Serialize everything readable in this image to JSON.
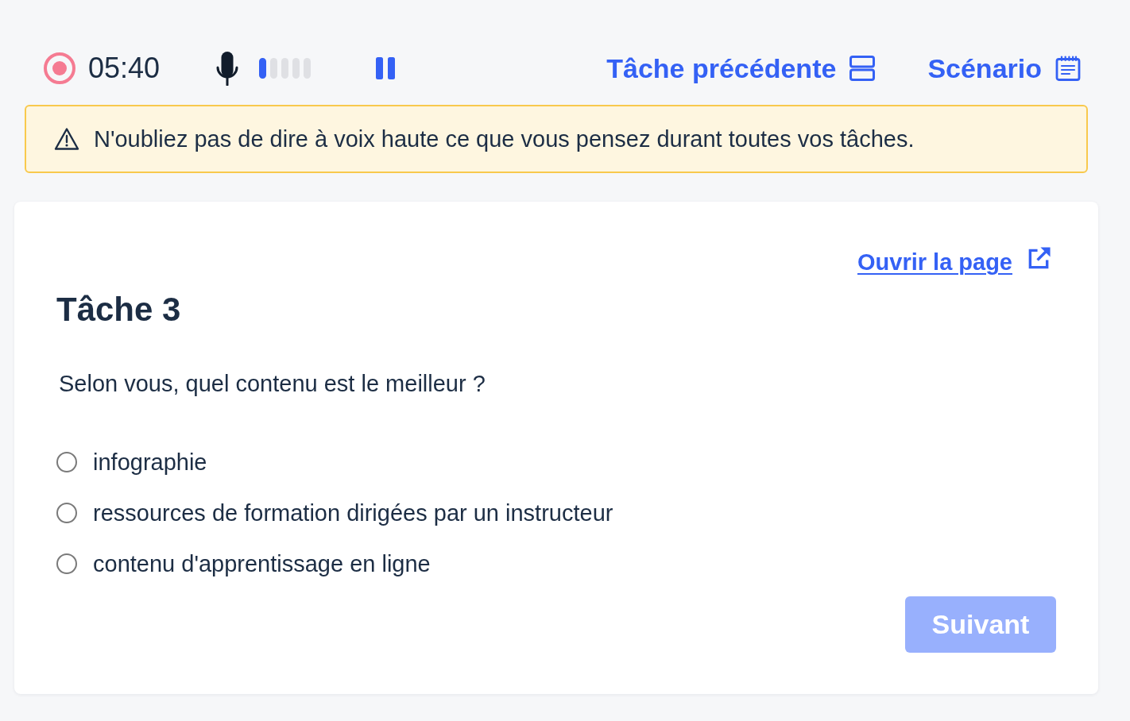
{
  "toolbar": {
    "recording": {
      "on": true,
      "time": "05:40"
    },
    "microphone": {
      "level": 0.2
    },
    "previous_task": {
      "label": "Tâche précédente"
    },
    "scenario": {
      "label": "Scénario"
    }
  },
  "reminder": {
    "message": "N'oubliez pas de dire à voix haute ce que vous pensez durant toutes vos tâches."
  },
  "task": {
    "open_link": "Ouvrir la page",
    "title": "Tâche 3",
    "question": "Selon vous, quel contenu est le meilleur ?",
    "options": [
      {
        "label": "infographie",
        "selected": false
      },
      {
        "label": "ressources de formation dirigées par un instructeur",
        "selected": false
      },
      {
        "label": "contenu d'apprentissage en ligne",
        "selected": false
      }
    ],
    "next_button": {
      "label": "Suivant",
      "disabled": true
    }
  }
}
